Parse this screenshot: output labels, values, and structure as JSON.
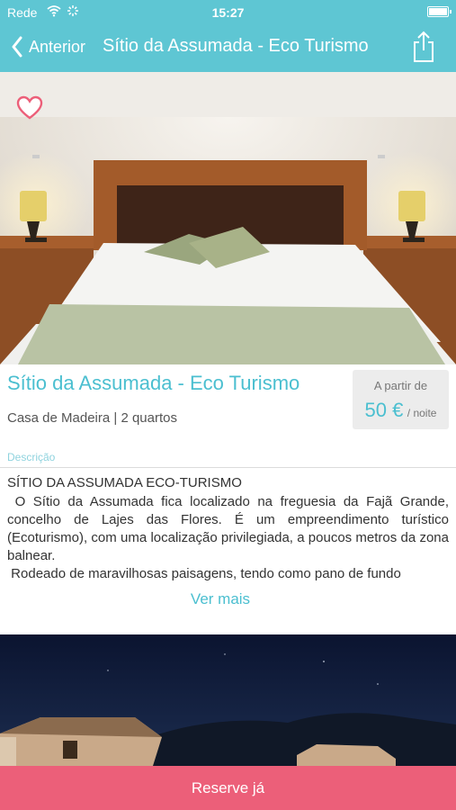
{
  "status": {
    "carrier": "Rede",
    "time": "15:27"
  },
  "nav": {
    "back_label": "Anterior",
    "title": "Sítio da Assumada - Eco Turismo"
  },
  "listing": {
    "title": "Sítio da Assumada - Eco Turismo",
    "subtitle": "Casa de Madeira | 2 quartos",
    "price_from": "A partir de",
    "price_value": "50 €",
    "price_unit": "/ noite"
  },
  "description": {
    "label": "Descrição",
    "heading": "SÍTIO DA ASSUMADA ECO-TURISMO",
    "body": " O Sítio da Assumada fica localizado na freguesia da Fajã Grande, concelho de Lajes das Flores. É um empreendimento turístico (Ecoturismo), com uma localização privilegiada, a poucos metros da zona balnear.\n Rodeado de maravilhosas paisagens, tendo como pano de fundo",
    "more_label": "Ver mais"
  },
  "actions": {
    "reserve_label": "Reserve já"
  },
  "colors": {
    "header": "#5ec6d3",
    "accent": "#4bbfd0",
    "reserve": "#ec5f79"
  },
  "icons": {
    "back": "chevron-left-icon",
    "share": "share-icon",
    "favorite": "heart-icon",
    "wifi": "wifi-icon",
    "battery": "battery-icon"
  }
}
